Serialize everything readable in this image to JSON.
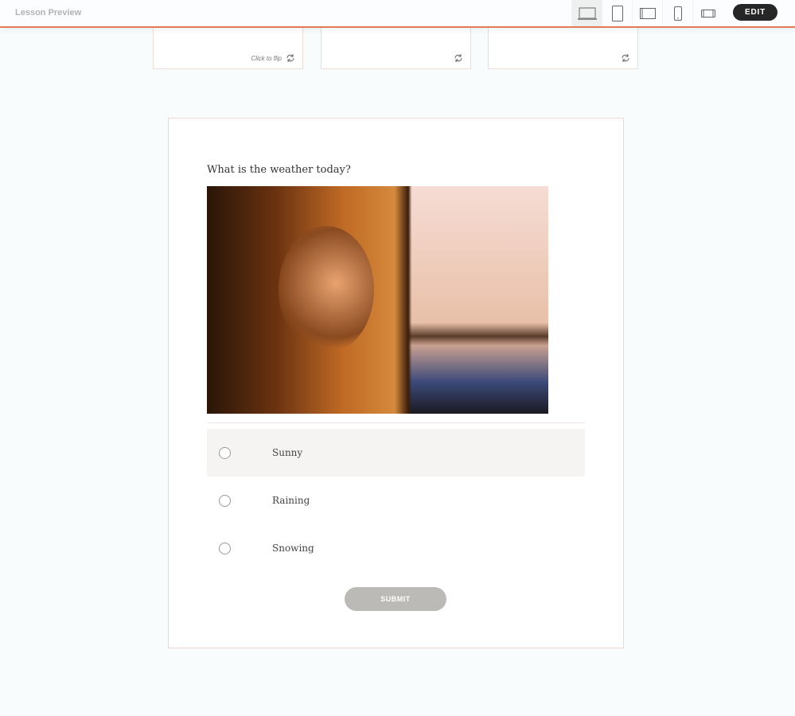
{
  "header": {
    "title": "Lesson Preview",
    "devices": [
      "laptop-icon",
      "tablet-portrait-icon",
      "tablet-landscape-icon",
      "phone-portrait-icon",
      "phone-landscape-icon"
    ],
    "edit_label": "EDIT"
  },
  "cards": [
    {
      "flip_label": "Click to flip"
    },
    {
      "flip_label": ""
    },
    {
      "flip_label": ""
    }
  ],
  "quiz": {
    "question": "What is the weather today?",
    "options": [
      "Sunny",
      "Raining",
      "Snowing"
    ],
    "submit_label": "SUBMIT"
  },
  "colors": {
    "accent": "#e07a57",
    "edit_bg": "#262626",
    "submit_bg": "#bcbab6"
  }
}
